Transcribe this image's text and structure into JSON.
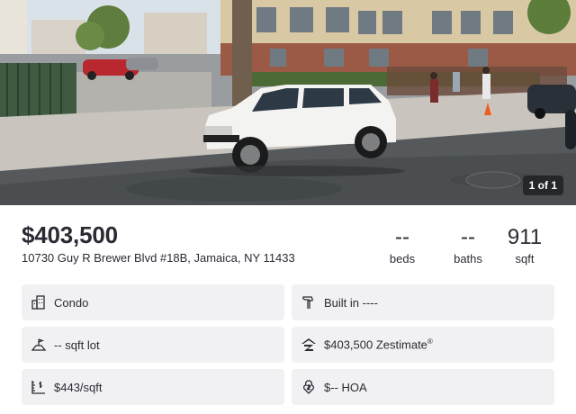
{
  "photo": {
    "counter": "1 of 1"
  },
  "listing": {
    "price": "$403,500",
    "address": "10730 Guy R Brewer Blvd #18B, Jamaica, NY 11433"
  },
  "stats": {
    "beds_value": "--",
    "beds_label": "beds",
    "baths_value": "--",
    "baths_label": "baths",
    "sqft_value": "911",
    "sqft_label": "sqft"
  },
  "facts": {
    "type": "Condo",
    "built": "Built in ----",
    "lot": "-- sqft lot",
    "zestimate": "$403,500 Zestimate",
    "zestimate_mark": "®",
    "price_per_sqft": "$443/sqft",
    "hoa": "$-- HOA"
  },
  "colors": {
    "text": "#2a2a33",
    "card_bg": "#f1f1f4",
    "counter_bg": "#1e1e23"
  }
}
